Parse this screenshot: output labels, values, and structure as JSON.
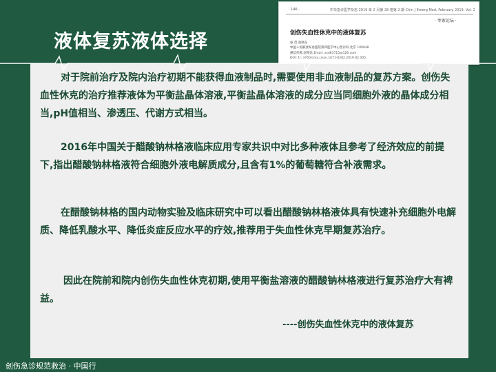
{
  "slide": {
    "title": "液体复苏液体选择",
    "paragraphs": [
      "对于院前治疗及院内治疗初期不能获得血液制品时,需要使用非血液制品的复苏方案。创伤失血性休克的治疗推荐液体为平衡盐晶体溶液,平衡盐晶体溶液的成分应当同细胞外液的晶体成分相当,pH值相当、渗透压、代谢方式相当。",
      "2016年中国关于醋酸钠林格液临床应用专家共识中对比多种液体且参考了经济效应的前提下,指出醋酸钠林格液符合细胞外液电解质成分,且含有1%的葡萄糖符合补液需求。",
      "在醋酸钠林格的国内动物实验及临床研究中可以看出醋酸钠林格液体具有快速补充细胞外电解质、降低乳酸水平、降低炎症反应水平的疗效,推荐用于失血性休克早期复苏治疗。",
      "因此在院前和院内创伤失血性休克初期,使用平衡盐溶液的醋酸钠林格液进行复苏治疗大有裨益。"
    ],
    "signature": "----创伤失血性休克中的液体复苏",
    "footer": "创伤急诊规范救治 · 中国行"
  },
  "journal_thumbnail": {
    "page_number": "· 146 ·",
    "header_right": "中华急诊医学杂志 2019 年 2 月第 28 卷第 2 期 Chin J Emerg Med, February 2019, Vol. 28, No. 2",
    "section": "· 专家论坛 ·",
    "article_title": "创伤失血性休克中的液体复苏",
    "authors": "张 茂   赵晓东",
    "affiliation": "中国人民解放军总医院第四医学中心急诊科,北京  100048",
    "correspondence": "通信作者:赵晓东,Email: zxd63715@126.com",
    "doi": "DOI: 10.3760/cma.j.issn.1671-0282.2019.02.005"
  },
  "colors": {
    "background": "#1f5a41",
    "panel": "#efefef",
    "text": "#1a4a33",
    "title": "#ffffff"
  }
}
